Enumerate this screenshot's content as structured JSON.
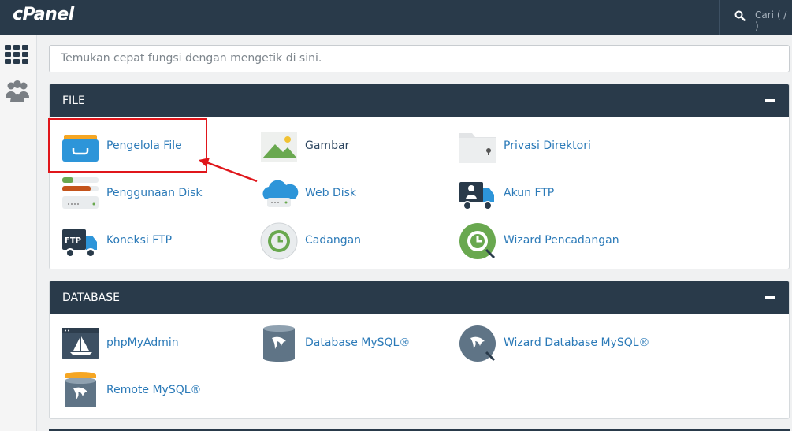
{
  "header": {
    "logo": "cPanel",
    "search_label": "Cari ( / )"
  },
  "quickfind": {
    "placeholder": "Temukan cepat fungsi dengan mengetik di sini."
  },
  "sections": [
    {
      "title": "FILE",
      "items": [
        {
          "label": "Pengelola File",
          "icon": "file-manager-icon"
        },
        {
          "label": "Gambar",
          "icon": "images-icon"
        },
        {
          "label": "Privasi Direktori",
          "icon": "directory-privacy-icon"
        },
        {
          "label": "Penggunaan Disk",
          "icon": "disk-usage-icon"
        },
        {
          "label": "Web Disk",
          "icon": "web-disk-icon"
        },
        {
          "label": "Akun FTP",
          "icon": "ftp-accounts-icon"
        },
        {
          "label": "Koneksi FTP",
          "icon": "ftp-connections-icon"
        },
        {
          "label": "Cadangan",
          "icon": "backup-icon"
        },
        {
          "label": "Wizard Pencadangan",
          "icon": "backup-wizard-icon"
        }
      ]
    },
    {
      "title": "DATABASE",
      "items": [
        {
          "label": "phpMyAdmin",
          "icon": "phpmyadmin-icon"
        },
        {
          "label": "Database MySQL®",
          "icon": "mysql-database-icon"
        },
        {
          "label": "Wizard Database MySQL®",
          "icon": "mysql-wizard-icon"
        },
        {
          "label": "Remote MySQL®",
          "icon": "remote-mysql-icon"
        }
      ]
    }
  ],
  "colors": {
    "header": "#293a4a",
    "link": "#2b7ab8",
    "highlight": "#e0161b"
  }
}
